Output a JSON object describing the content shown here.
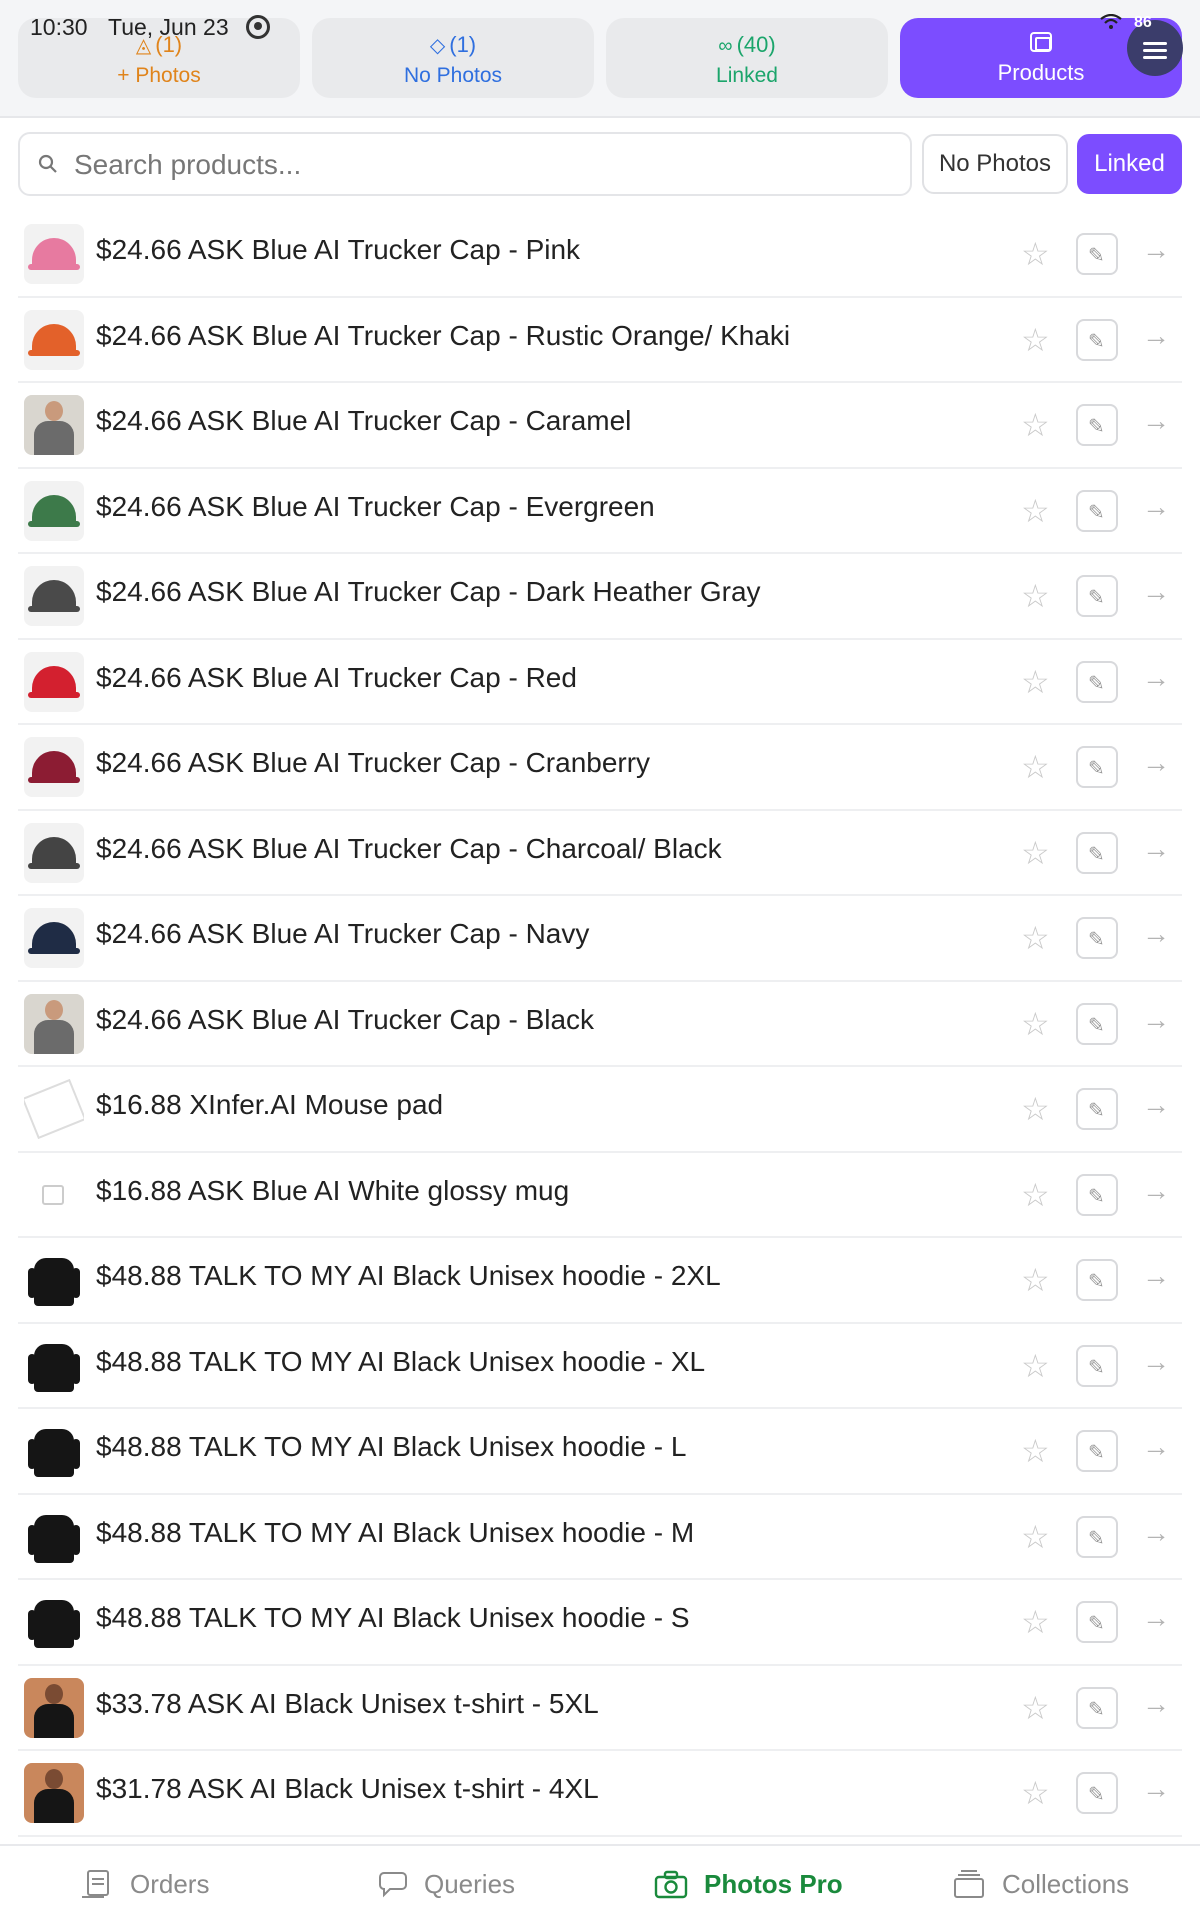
{
  "status_bar": {
    "time": "10:30",
    "date": "Tue, Jun 23",
    "battery": "86"
  },
  "tabs": [
    {
      "count": "(1)",
      "label": "+ Photos",
      "icon": "image-icon",
      "color": "#e0841b"
    },
    {
      "count": "(1)",
      "label": "No Photos",
      "icon": "tag-icon",
      "color": "#2f6fdf"
    },
    {
      "count": "(40)",
      "label": "Linked",
      "icon": "link-icon",
      "color": "#1ba56b"
    },
    {
      "count": "",
      "label": "Products",
      "icon": "gallery-icon",
      "color": "#7c4dff"
    }
  ],
  "search": {
    "placeholder": "Search products...",
    "value": ""
  },
  "filters": {
    "no_photos": "No Photos",
    "linked": "Linked"
  },
  "products": [
    {
      "title": "$24.66 ASK Blue AI Trucker Cap - Pink",
      "thumb": "cap",
      "color": "#e77aa0"
    },
    {
      "title": "$24.66 ASK Blue AI Trucker Cap - Rustic Orange/ Khaki",
      "thumb": "cap",
      "color": "#e3612a"
    },
    {
      "title": "$24.66 ASK Blue AI Trucker Cap - Caramel",
      "thumb": "person",
      "color": "#6b6b6b"
    },
    {
      "title": "$24.66 ASK Blue AI Trucker Cap - Evergreen",
      "thumb": "cap",
      "color": "#3d7a4a"
    },
    {
      "title": "$24.66 ASK Blue AI Trucker Cap - Dark Heather Gray",
      "thumb": "cap",
      "color": "#4a4a4a"
    },
    {
      "title": "$24.66 ASK Blue AI Trucker Cap - Red",
      "thumb": "cap",
      "color": "#d3202f"
    },
    {
      "title": "$24.66 ASK Blue AI Trucker Cap - Cranberry",
      "thumb": "cap",
      "color": "#8c1c33"
    },
    {
      "title": "$24.66 ASK Blue AI Trucker Cap - Charcoal/ Black",
      "thumb": "cap",
      "color": "#444444"
    },
    {
      "title": "$24.66 ASK Blue AI Trucker Cap - Navy",
      "thumb": "cap",
      "color": "#1f2c45"
    },
    {
      "title": "$24.66 ASK Blue AI Trucker Cap - Black",
      "thumb": "person",
      "color": "#6b6b6b"
    },
    {
      "title": "$16.88 XInfer.AI Mouse pad",
      "thumb": "pad",
      "color": "#ffffff"
    },
    {
      "title": "$16.88 ASK Blue AI White glossy mug",
      "thumb": "mug",
      "color": "#ffffff"
    },
    {
      "title": "$48.88 TALK TO MY AI Black Unisex hoodie - 2XL",
      "thumb": "hoodie",
      "color": "#151515"
    },
    {
      "title": "$48.88 TALK TO MY AI Black Unisex hoodie - XL",
      "thumb": "hoodie",
      "color": "#151515"
    },
    {
      "title": "$48.88 TALK TO MY AI Black Unisex hoodie - L",
      "thumb": "hoodie",
      "color": "#151515"
    },
    {
      "title": "$48.88 TALK TO MY AI Black Unisex hoodie - M",
      "thumb": "hoodie",
      "color": "#151515"
    },
    {
      "title": "$48.88 TALK TO MY AI Black Unisex hoodie - S",
      "thumb": "hoodie",
      "color": "#151515"
    },
    {
      "title": "$33.78 ASK AI Black Unisex t-shirt - 5XL",
      "thumb": "tshirt",
      "color": "#c9875c"
    },
    {
      "title": "$31.78 ASK AI Black Unisex t-shirt - 4XL",
      "thumb": "tshirt",
      "color": "#c9875c"
    }
  ],
  "bottom_nav": [
    {
      "label": "Orders",
      "icon": "clipboard-icon",
      "active": false
    },
    {
      "label": "Queries",
      "icon": "chat-bubbles-icon",
      "active": false
    },
    {
      "label": "Photos Pro",
      "icon": "camera-icon",
      "active": true
    },
    {
      "label": "Collections",
      "icon": "stack-icon",
      "active": false
    }
  ],
  "colors": {
    "accent": "#7c4dff",
    "active_nav": "#1a8a3c"
  }
}
